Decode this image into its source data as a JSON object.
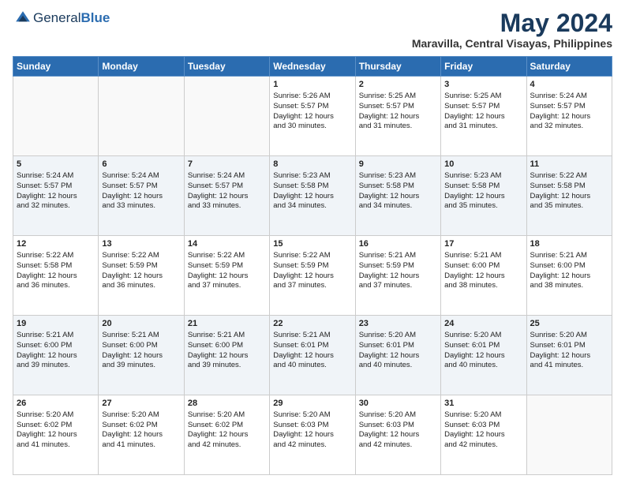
{
  "header": {
    "logo_general": "General",
    "logo_blue": "Blue",
    "title": "May 2024",
    "subtitle": "Maravilla, Central Visayas, Philippines"
  },
  "weekdays": [
    "Sunday",
    "Monday",
    "Tuesday",
    "Wednesday",
    "Thursday",
    "Friday",
    "Saturday"
  ],
  "weeks": [
    [
      {
        "day": "",
        "info": ""
      },
      {
        "day": "",
        "info": ""
      },
      {
        "day": "",
        "info": ""
      },
      {
        "day": "1",
        "info": "Sunrise: 5:26 AM\nSunset: 5:57 PM\nDaylight: 12 hours\nand 30 minutes."
      },
      {
        "day": "2",
        "info": "Sunrise: 5:25 AM\nSunset: 5:57 PM\nDaylight: 12 hours\nand 31 minutes."
      },
      {
        "day": "3",
        "info": "Sunrise: 5:25 AM\nSunset: 5:57 PM\nDaylight: 12 hours\nand 31 minutes."
      },
      {
        "day": "4",
        "info": "Sunrise: 5:24 AM\nSunset: 5:57 PM\nDaylight: 12 hours\nand 32 minutes."
      }
    ],
    [
      {
        "day": "5",
        "info": "Sunrise: 5:24 AM\nSunset: 5:57 PM\nDaylight: 12 hours\nand 32 minutes."
      },
      {
        "day": "6",
        "info": "Sunrise: 5:24 AM\nSunset: 5:57 PM\nDaylight: 12 hours\nand 33 minutes."
      },
      {
        "day": "7",
        "info": "Sunrise: 5:24 AM\nSunset: 5:57 PM\nDaylight: 12 hours\nand 33 minutes."
      },
      {
        "day": "8",
        "info": "Sunrise: 5:23 AM\nSunset: 5:58 PM\nDaylight: 12 hours\nand 34 minutes."
      },
      {
        "day": "9",
        "info": "Sunrise: 5:23 AM\nSunset: 5:58 PM\nDaylight: 12 hours\nand 34 minutes."
      },
      {
        "day": "10",
        "info": "Sunrise: 5:23 AM\nSunset: 5:58 PM\nDaylight: 12 hours\nand 35 minutes."
      },
      {
        "day": "11",
        "info": "Sunrise: 5:22 AM\nSunset: 5:58 PM\nDaylight: 12 hours\nand 35 minutes."
      }
    ],
    [
      {
        "day": "12",
        "info": "Sunrise: 5:22 AM\nSunset: 5:58 PM\nDaylight: 12 hours\nand 36 minutes."
      },
      {
        "day": "13",
        "info": "Sunrise: 5:22 AM\nSunset: 5:59 PM\nDaylight: 12 hours\nand 36 minutes."
      },
      {
        "day": "14",
        "info": "Sunrise: 5:22 AM\nSunset: 5:59 PM\nDaylight: 12 hours\nand 37 minutes."
      },
      {
        "day": "15",
        "info": "Sunrise: 5:22 AM\nSunset: 5:59 PM\nDaylight: 12 hours\nand 37 minutes."
      },
      {
        "day": "16",
        "info": "Sunrise: 5:21 AM\nSunset: 5:59 PM\nDaylight: 12 hours\nand 37 minutes."
      },
      {
        "day": "17",
        "info": "Sunrise: 5:21 AM\nSunset: 6:00 PM\nDaylight: 12 hours\nand 38 minutes."
      },
      {
        "day": "18",
        "info": "Sunrise: 5:21 AM\nSunset: 6:00 PM\nDaylight: 12 hours\nand 38 minutes."
      }
    ],
    [
      {
        "day": "19",
        "info": "Sunrise: 5:21 AM\nSunset: 6:00 PM\nDaylight: 12 hours\nand 39 minutes."
      },
      {
        "day": "20",
        "info": "Sunrise: 5:21 AM\nSunset: 6:00 PM\nDaylight: 12 hours\nand 39 minutes."
      },
      {
        "day": "21",
        "info": "Sunrise: 5:21 AM\nSunset: 6:00 PM\nDaylight: 12 hours\nand 39 minutes."
      },
      {
        "day": "22",
        "info": "Sunrise: 5:21 AM\nSunset: 6:01 PM\nDaylight: 12 hours\nand 40 minutes."
      },
      {
        "day": "23",
        "info": "Sunrise: 5:20 AM\nSunset: 6:01 PM\nDaylight: 12 hours\nand 40 minutes."
      },
      {
        "day": "24",
        "info": "Sunrise: 5:20 AM\nSunset: 6:01 PM\nDaylight: 12 hours\nand 40 minutes."
      },
      {
        "day": "25",
        "info": "Sunrise: 5:20 AM\nSunset: 6:01 PM\nDaylight: 12 hours\nand 41 minutes."
      }
    ],
    [
      {
        "day": "26",
        "info": "Sunrise: 5:20 AM\nSunset: 6:02 PM\nDaylight: 12 hours\nand 41 minutes."
      },
      {
        "day": "27",
        "info": "Sunrise: 5:20 AM\nSunset: 6:02 PM\nDaylight: 12 hours\nand 41 minutes."
      },
      {
        "day": "28",
        "info": "Sunrise: 5:20 AM\nSunset: 6:02 PM\nDaylight: 12 hours\nand 42 minutes."
      },
      {
        "day": "29",
        "info": "Sunrise: 5:20 AM\nSunset: 6:03 PM\nDaylight: 12 hours\nand 42 minutes."
      },
      {
        "day": "30",
        "info": "Sunrise: 5:20 AM\nSunset: 6:03 PM\nDaylight: 12 hours\nand 42 minutes."
      },
      {
        "day": "31",
        "info": "Sunrise: 5:20 AM\nSunset: 6:03 PM\nDaylight: 12 hours\nand 42 minutes."
      },
      {
        "day": "",
        "info": ""
      }
    ]
  ]
}
